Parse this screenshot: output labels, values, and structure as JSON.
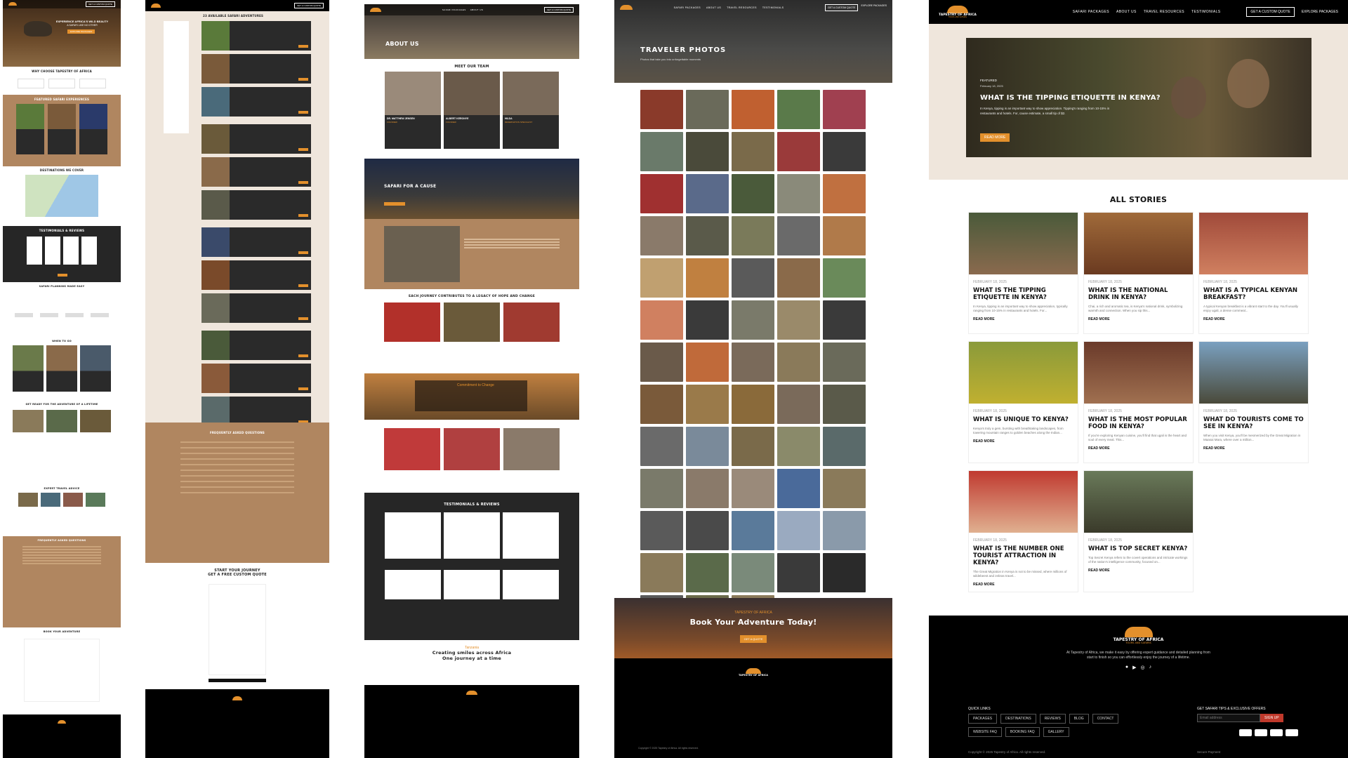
{
  "brand": {
    "name": "TAPESTRY OF AFRICA",
    "sub": "TOURS AND SAFARIS",
    "accent": "#e3902c"
  },
  "nav": {
    "links": [
      "SAFARI PACKAGES",
      "ABOUT US",
      "TRAVEL RESOURCES",
      "TESTIMONIALS"
    ],
    "cta_quote": "GET A CUSTOM QUOTE",
    "cta_explore": "EXPLORE PACKAGES"
  },
  "page1": {
    "hero_title": "EXPERIENCE AFRICA'S WILD BEAUTY",
    "hero_sub": "A SAFARI LIKE NO OTHER",
    "why_title": "WHY CHOOSE TAPESTRY OF AFRICA",
    "featured_title": "FEATURED SAFARI EXPERIENCES",
    "destinations_title": "DESTINATIONS WE COVER",
    "testimonials_title": "TESTIMONIALS & REVIEWS",
    "planning_title": "SAFARI PLANNING MADE EASY",
    "when_title": "WHEN TO GO",
    "guides_title": "GET READY FOR THE ADVENTURE OF A LIFETIME",
    "advice_title": "EXPERT TRAVEL ADVICE",
    "faq_title": "FREQUENTLY ASKED QUESTIONS",
    "book_title": "BOOK YOUR ADVENTURE"
  },
  "page2": {
    "list_title": "23 AVAILABLE SAFARI ADVENTURES",
    "faq_title": "FREQUENTLY ASKED QUESTIONS",
    "cta_line1": "START YOUR JOURNEY",
    "cta_line2": "GET A FREE CUSTOM QUOTE"
  },
  "page3": {
    "hero_title": "ABOUT US",
    "team_title": "MEET OUR TEAM",
    "team": [
      {
        "name": "DR. MATTHEW JENSEN",
        "role": "FOUNDER"
      },
      {
        "name": "ALBERT KERONYE",
        "role": "FOUNDER"
      },
      {
        "name": "HILDA",
        "role": "RESERVATION SPECIALIST"
      }
    ],
    "cause_title": "SAFARI FOR A CAUSE",
    "legacy_title": "EACH JOURNEY CONTRIBUTES TO A LEGACY OF HOPE AND CHANGE",
    "commit_title": "Commitment to Change",
    "testimonials_title": "TESTIMONIALS & REVIEWS",
    "smiles_kicker": "Tanzania",
    "smiles_line1": "Creating smiles across Africa",
    "smiles_line2": "One journey at a time"
  },
  "page4": {
    "hero_title": "TRAVELER PHOTOS",
    "hero_sub": "Photos that take you into unforgettable moments",
    "cta_kicker": "TAPESTRY OF AFRICA",
    "cta_title": "Book Your Adventure Today!",
    "cta_button": "GET A QUOTE",
    "copyright": "Copyright © 2025 Tapestry of Africa. All rights reserved."
  },
  "page5": {
    "featured_label": "FEATURED",
    "featured_date": "February 18, 2025",
    "featured_title": "WHAT IS THE TIPPING ETIQUETTE IN KENYA?",
    "featured_excerpt": "In Kenya, tipping is an important way to show appreciation. Tipping's ranging from 10-15% in restaurants and hotels. For, cause estimate, a small tip of $2.",
    "read_more": "READ MORE",
    "section_title": "ALL STORIES",
    "stories": [
      {
        "date": "FEBRUARY 18, 2025",
        "title": "WHAT IS THE TIPPING ETIQUETTE IN KENYA?",
        "excerpt": "In Kenya, tipping is an important way to show appreciation, typically ranging from 10-15% in restaurants and hotels. For...",
        "more": "READ MORE"
      },
      {
        "date": "FEBRUARY 18, 2025",
        "title": "WHAT IS THE NATIONAL DRINK IN KENYA?",
        "excerpt": "Chai, a rich and aromatic tea, is Kenya's national drink, symbolizing warmth and connection. When you sip this...",
        "more": "READ MORE"
      },
      {
        "date": "FEBRUARY 18, 2025",
        "title": "WHAT IS A TYPICAL KENYAN BREAKFAST?",
        "excerpt": "A typical Kenyan breakfast is a vibrant start to the day. You'll usually enjoy ugali, a dense cornmeal...",
        "more": "READ MORE"
      },
      {
        "date": "FEBRUARY 18, 2025",
        "title": "WHAT IS UNIQUE TO KENYA?",
        "excerpt": "Kenya's truly a gem, bursting with breathtaking landscapes, from towering mountain ranges to golden beaches along the Indian...",
        "more": "READ MORE"
      },
      {
        "date": "FEBRUARY 18, 2025",
        "title": "WHAT IS THE MOST POPULAR FOOD IN KENYA?",
        "excerpt": "If you're exploring Kenyan cuisine, you'll find that ugali is the heart and soul of every meal. This...",
        "more": "READ MORE"
      },
      {
        "date": "FEBRUARY 18, 2025",
        "title": "WHAT DO TOURISTS COME TO SEE IN KENYA?",
        "excerpt": "When you visit Kenya, you'll be mesmerized by the Great Migration in Maasai Mara, where over a million...",
        "more": "READ MORE"
      },
      {
        "date": "FEBRUARY 18, 2025",
        "title": "WHAT IS THE NUMBER ONE TOURIST ATTRACTION IN KENYA?",
        "excerpt": "The Great Migration in Kenya is not to be missed, where millions of wildebeest and zebras travel...",
        "more": "READ MORE"
      },
      {
        "date": "FEBRUARY 18, 2025",
        "title": "WHAT IS TOP SECRET KENYA?",
        "excerpt": "Top Secret Kenya refers to the covert operations and intricate workings of the nation's intelligence community, focused on...",
        "more": "READ MORE"
      }
    ],
    "footer_about": "At Tapestry of Africa, we make it easy by offering expert guidance and detailed planning from start to finish so you can effortlessly enjoy the journey of a lifetime.",
    "quick_links_title": "QUICK LINKS",
    "quick_links": [
      "PACKAGES",
      "DESTINATIONS",
      "REVIEWS",
      "BLOG",
      "CONTACT",
      "WEBSITE FAQ",
      "BOOKING FAQ",
      "GALLERY"
    ],
    "newsletter_title": "GET SAFARI TIPS & EXCLUSIVE OFFERS",
    "newsletter_placeholder": "Email address",
    "newsletter_button": "SIGN UP",
    "copyright": "Copyright © 2025 Tapestry of Africa. All rights reserved.",
    "secure": "Secure Payment"
  }
}
